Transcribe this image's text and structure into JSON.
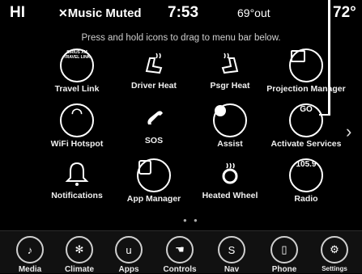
{
  "status": {
    "greeting": "HI",
    "mute_text": "Music Muted",
    "time": "7:53",
    "outside_temp": "69°out",
    "cabin_temp": "72°"
  },
  "instruction": "Press and hold icons to drag to menu bar below.",
  "tiles": [
    {
      "label": "Travel Link",
      "icon": "travel-link-icon",
      "inner": "SIRIUS XM TRAVEL LINK"
    },
    {
      "label": "Driver Heat",
      "icon": "driver-heat-icon"
    },
    {
      "label": "Psgr Heat",
      "icon": "passenger-heat-icon"
    },
    {
      "label": "Projection Manager",
      "icon": "projection-manager-icon"
    },
    {
      "label": "WiFi Hotspot",
      "icon": "wifi-icon"
    },
    {
      "label": "SOS",
      "icon": "sos-phone-icon"
    },
    {
      "label": "Assist",
      "icon": "assist-person-icon"
    },
    {
      "label": "Activate Services",
      "icon": "go-icon",
      "inner": "GO"
    },
    {
      "label": "Notifications",
      "icon": "bell-icon"
    },
    {
      "label": "App Manager",
      "icon": "app-manager-icon"
    },
    {
      "label": "Heated Wheel",
      "icon": "heated-wheel-icon"
    },
    {
      "label": "Radio",
      "icon": "radio-icon",
      "inner": "105.9"
    }
  ],
  "nav": [
    {
      "label": "Media",
      "icon": "media-icon"
    },
    {
      "label": "Climate",
      "icon": "climate-icon"
    },
    {
      "label": "Apps",
      "icon": "apps-icon"
    },
    {
      "label": "Controls",
      "icon": "controls-icon"
    },
    {
      "label": "Nav",
      "icon": "nav-icon"
    },
    {
      "label": "Phone",
      "icon": "phone-icon"
    },
    {
      "label": "Settings",
      "icon": "settings-gear-icon"
    }
  ]
}
